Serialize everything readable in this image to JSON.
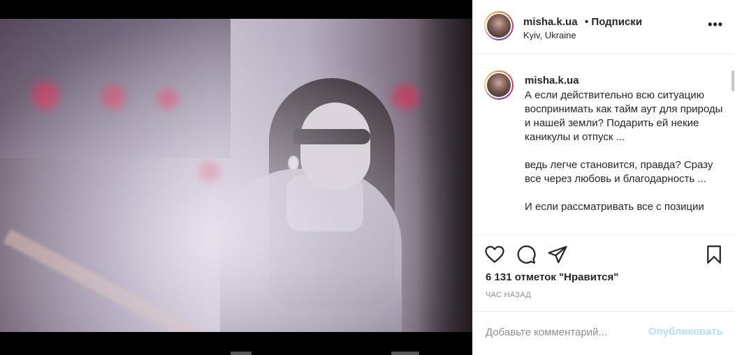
{
  "post": {
    "username": "misha.k.ua",
    "follow_label": "• Подписки",
    "location": "Kyiv, Ukraine",
    "more_label": "•••"
  },
  "caption": {
    "username": "misha.k.ua",
    "text": "А если действительно всю ситуацию воспринимать как тайм аут для природы и нашей земли? Подарить ей некие каникулы и отпуск ...\n\nведь легче становится, правда? Сразу все через любовь и благодарность ...\n\nИ если рассматривать все с позиции"
  },
  "actions": {
    "like_icon": "heart-icon",
    "comment_icon": "comment-icon",
    "share_icon": "paper-plane-icon",
    "save_icon": "bookmark-icon"
  },
  "likes_text": "6 131 отметок \"Нравится\"",
  "time_text": "ЧАС НАЗАД",
  "comment": {
    "placeholder": "Добавьте комментарий...",
    "publish_label": "Опубликовать"
  },
  "colors": {
    "accent_disabled": "#b2dffc",
    "text": "#262626",
    "muted": "#8e8e8e"
  }
}
